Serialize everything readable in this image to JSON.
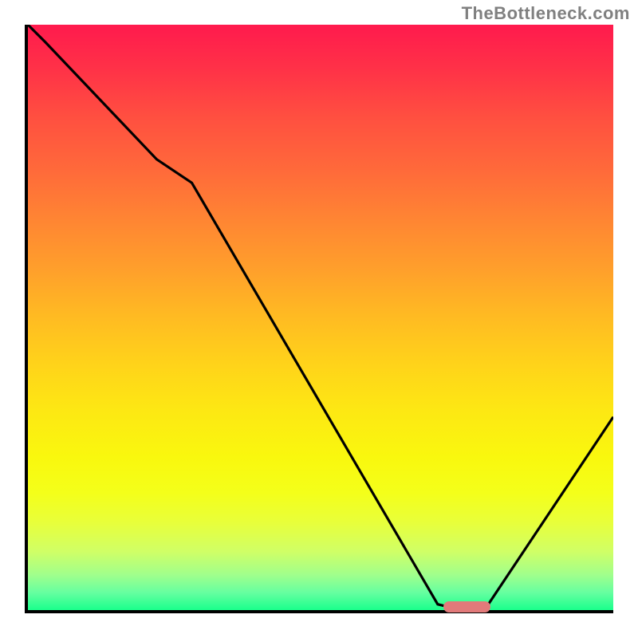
{
  "attribution": "TheBottleneck.com",
  "chart_data": {
    "type": "line",
    "title": "",
    "xlabel": "",
    "ylabel": "",
    "xlim": [
      0,
      100
    ],
    "ylim": [
      0,
      100
    ],
    "x": [
      0,
      3,
      22,
      28,
      70,
      74,
      78,
      100
    ],
    "values": [
      100,
      97,
      77,
      73,
      1,
      0,
      0,
      33
    ],
    "marker": {
      "x_start": 71,
      "x_end": 79,
      "y": 0
    },
    "gradient_stops": [
      {
        "pos": 0,
        "color": "#ff1a4d"
      },
      {
        "pos": 25,
        "color": "#ff6a3a"
      },
      {
        "pos": 50,
        "color": "#ffbb22"
      },
      {
        "pos": 75,
        "color": "#f9f80e"
      },
      {
        "pos": 100,
        "color": "#1aff8c"
      }
    ]
  }
}
